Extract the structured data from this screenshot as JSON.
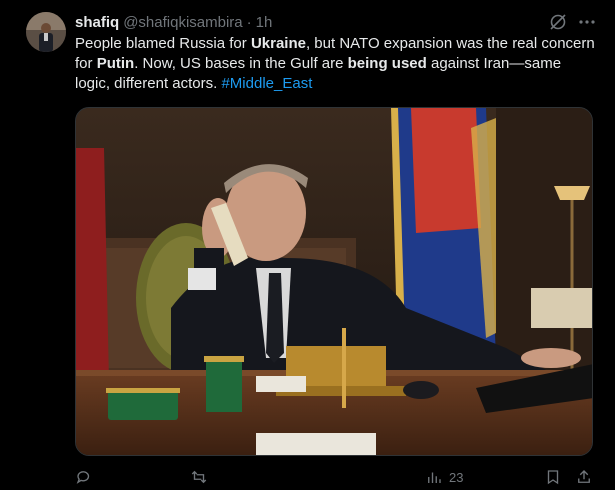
{
  "post": {
    "display_name": "shafiq",
    "handle": "@shafiqkisambira",
    "separator": "·",
    "time": "1h",
    "text": {
      "p1": "People blamed Russia for ",
      "b1": "Ukraine",
      "p2": ", but NATO expansion was the real concern for ",
      "b2": "Putin",
      "p3": ". Now, US bases in the Gulf are ",
      "b3": "being used",
      "p4": " against Iran—same logic, different actors. ",
      "hashtag": "#Middle_East"
    },
    "media_alt_icon": "photo-of-man-on-phone-at-desk"
  },
  "actions": {
    "reply": {
      "icon": "reply-icon",
      "count": ""
    },
    "repost": {
      "icon": "repost-icon",
      "count": ""
    },
    "views": {
      "icon": "views-icon",
      "count": "23"
    },
    "bookmark": {
      "icon": "bookmark-icon"
    },
    "share": {
      "icon": "share-icon"
    }
  },
  "colors": {
    "background": "#000000",
    "text": "#e7e9ea",
    "muted": "#71767b",
    "link": "#1d9bf0"
  }
}
